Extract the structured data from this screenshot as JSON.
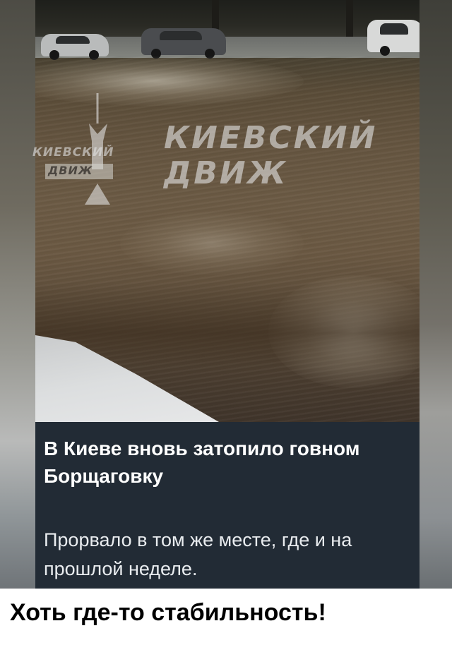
{
  "watermark": {
    "large_line1": "КИЕВСКИЙ",
    "large_line2": "ДВИЖ",
    "logo_line1": "КИЕВСКИЙ",
    "logo_line2": "ДВИЖ"
  },
  "post": {
    "headline": "В Киеве вновь затопило говном\nБорщаговку",
    "body": "Прорвало в том же месте, где и на\nпрошлой неделе."
  },
  "meme": {
    "caption": "Хоть где-то стабильность!"
  },
  "colors": {
    "caption_panel": "#222b35",
    "page_background": "#ffffff"
  }
}
